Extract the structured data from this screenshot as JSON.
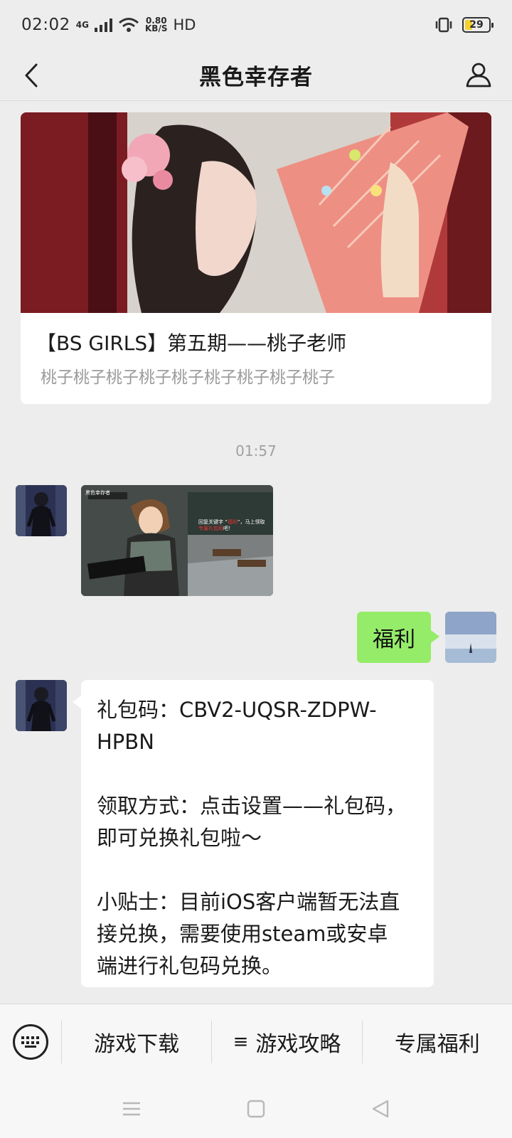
{
  "status_bar": {
    "time": "02:02",
    "network": "4G",
    "speed_value": "0.80",
    "speed_unit": "KB/S",
    "hd": "HD",
    "battery": "29"
  },
  "header": {
    "title": "黑色幸存者"
  },
  "article": {
    "title": "【BS GIRLS】第五期——桃子老师",
    "digest": "桃子桃子桃子桃子桃子桃子桃子桃子桃子"
  },
  "chat": {
    "timestamp": "01:57",
    "game_image_caption_pre": "回复关键字 “",
    "game_image_caption_kw": "福利",
    "game_image_caption_mid": "”，马上领取",
    "game_image_caption_hl": "专属礼包码",
    "game_image_caption_post": "吧！",
    "game_image_tag": "黑色幸存者",
    "user_message": "福利",
    "bot_reply": {
      "line1": "礼包码：CBV2-UQSR-ZDPW-\nHPBN",
      "line2": "领取方式：点击设置——礼包码，\n即可兑换礼包啦～",
      "line3": "小贴士：目前iOS客户端暂无法直\n接兑换，需要使用steam或安卓\n端进行礼包码兑换。"
    }
  },
  "menu": {
    "items": [
      {
        "label": "游戏下载"
      },
      {
        "label": "游戏攻略",
        "icon": "≡"
      },
      {
        "label": "专属福利"
      }
    ]
  },
  "colors": {
    "background": "#ededed",
    "user_bubble": "#95ec69",
    "bot_bubble": "#ffffff"
  }
}
